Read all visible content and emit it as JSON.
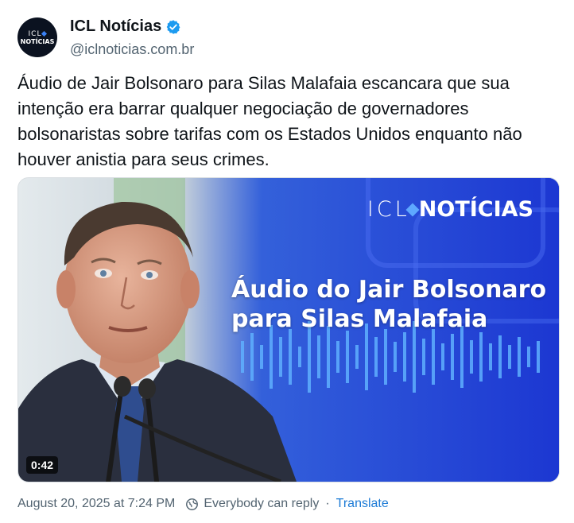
{
  "account": {
    "name": "ICL Notícias",
    "handle": "@iclnoticias.com.br",
    "avatar_line1": "ICL",
    "avatar_line2": "NOTÍCIAS",
    "verified_color": "#1d9bf0"
  },
  "post": {
    "text": "Áudio de Jair Bolsonaro para Silas Malafaia escancara que sua intenção era barrar qualquer negociação de governadores bolsonaristas sobre tarifas com os Estados Unidos enquanto não houver anistia para seus crimes."
  },
  "media": {
    "brand_left": "ICL",
    "brand_right": "NOTÍCIAS",
    "headline_line1": "Áudio do Jair Bolsonaro",
    "headline_line2": "para Silas Malafaia",
    "duration": "0:42",
    "accent": "#1d3fe0"
  },
  "footer": {
    "timestamp": "August 20, 2025 at 7:24 PM",
    "reply_setting": "Everybody can reply",
    "separator": "·",
    "translate": "Translate",
    "link_color": "#1d7bd6"
  }
}
